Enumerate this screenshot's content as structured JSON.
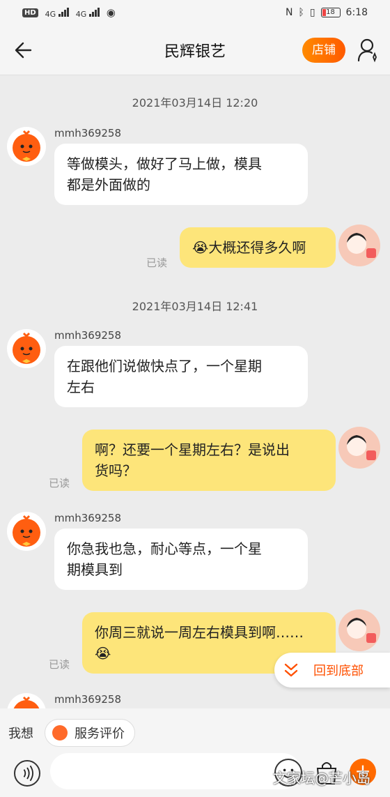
{
  "status_bar": {
    "left_label": "HD",
    "network": "4G",
    "network2": "4G",
    "battery": "18",
    "time": "6:18"
  },
  "header": {
    "title": "民辉银艺",
    "shop_button": "店铺"
  },
  "messages": [
    {
      "type": "timestamp",
      "text": "2021年03月14日 12:20"
    },
    {
      "type": "received",
      "sender": "mmh369258",
      "line1": "等做模头，做好了马上做，模具",
      "line2": "都是外面做的"
    },
    {
      "type": "sent",
      "text": "大概还得多久啊",
      "status": "已读"
    },
    {
      "type": "timestamp",
      "text": "2021年03月14日 12:41"
    },
    {
      "type": "received",
      "sender": "mmh369258",
      "line1": "在跟他们说做快点了，一个星期",
      "line2": "左右"
    },
    {
      "type": "sent",
      "line1": "啊？还要一个星期左右？是说出",
      "line2": "货吗？",
      "status": "已读"
    },
    {
      "type": "received",
      "sender": "mmh369258",
      "line1": "你急我也急，耐心等点，一个星",
      "line2": "期模具到"
    },
    {
      "type": "sent",
      "line1": "你周三就说一周左右模具到啊……",
      "status": "已读"
    },
    {
      "type": "received",
      "sender": "mmh369258"
    }
  ],
  "back_to_bottom": "回到底部",
  "quick_bar": {
    "label": "我想",
    "service_rating": "服务评价"
  },
  "input": {
    "placeholder": ""
  },
  "watermark": "文家坛@芒小岛",
  "colors": {
    "accent": "#ff5000",
    "sent_bubble": "#fde57a",
    "received_bubble": "#ffffff",
    "background": "#ececec"
  }
}
